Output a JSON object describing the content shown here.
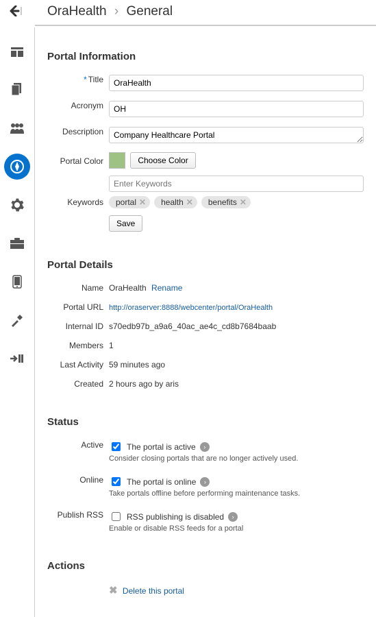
{
  "breadcrumb": {
    "parent": "OraHealth",
    "current": "General"
  },
  "nav": {
    "items": [
      {
        "name": "dashboard-icon"
      },
      {
        "name": "pages-icon"
      },
      {
        "name": "members-icon"
      },
      {
        "name": "compass-icon"
      },
      {
        "name": "settings-icon"
      },
      {
        "name": "toolbox-icon"
      },
      {
        "name": "mobile-icon"
      },
      {
        "name": "build-icon"
      },
      {
        "name": "import-icon"
      }
    ]
  },
  "portal_info": {
    "heading": "Portal Information",
    "title_label": "Title",
    "title_value": "OraHealth",
    "acronym_label": "Acronym",
    "acronym_value": "OH",
    "description_label": "Description",
    "description_value": "Company Healthcare Portal",
    "color_label": "Portal Color",
    "color_value": "#9dc284",
    "choose_color_label": "Choose Color",
    "keywords_label": "Keywords",
    "keywords_placeholder": "Enter Keywords",
    "keywords": [
      "portal",
      "health",
      "benefits"
    ],
    "save_label": "Save"
  },
  "portal_details": {
    "heading": "Portal Details",
    "name_label": "Name",
    "name_value": "OraHealth",
    "rename_label": "Rename",
    "url_label": "Portal URL",
    "url_value": "http://oraserver:8888/webcenter/portal/OraHealth",
    "internal_id_label": "Internal ID",
    "internal_id_value": "s70edb97b_a9a6_40ac_ae4c_cd8b7684baab",
    "members_label": "Members",
    "members_value": "1",
    "last_activity_label": "Last Activity",
    "last_activity_value": "59 minutes ago",
    "created_label": "Created",
    "created_value": "2 hours ago by aris"
  },
  "status": {
    "heading": "Status",
    "active_label": "Active",
    "active_text": "The portal is active",
    "active_help": "Consider closing portals that are no longer actively used.",
    "online_label": "Online",
    "online_text": "The portal is online",
    "online_help": "Take portals offline before performing maintenance tasks.",
    "rss_label": "Publish RSS",
    "rss_text": "RSS publishing is disabled",
    "rss_help": "Enable or disable RSS feeds for a portal"
  },
  "actions": {
    "heading": "Actions",
    "delete_label": "Delete this portal"
  }
}
